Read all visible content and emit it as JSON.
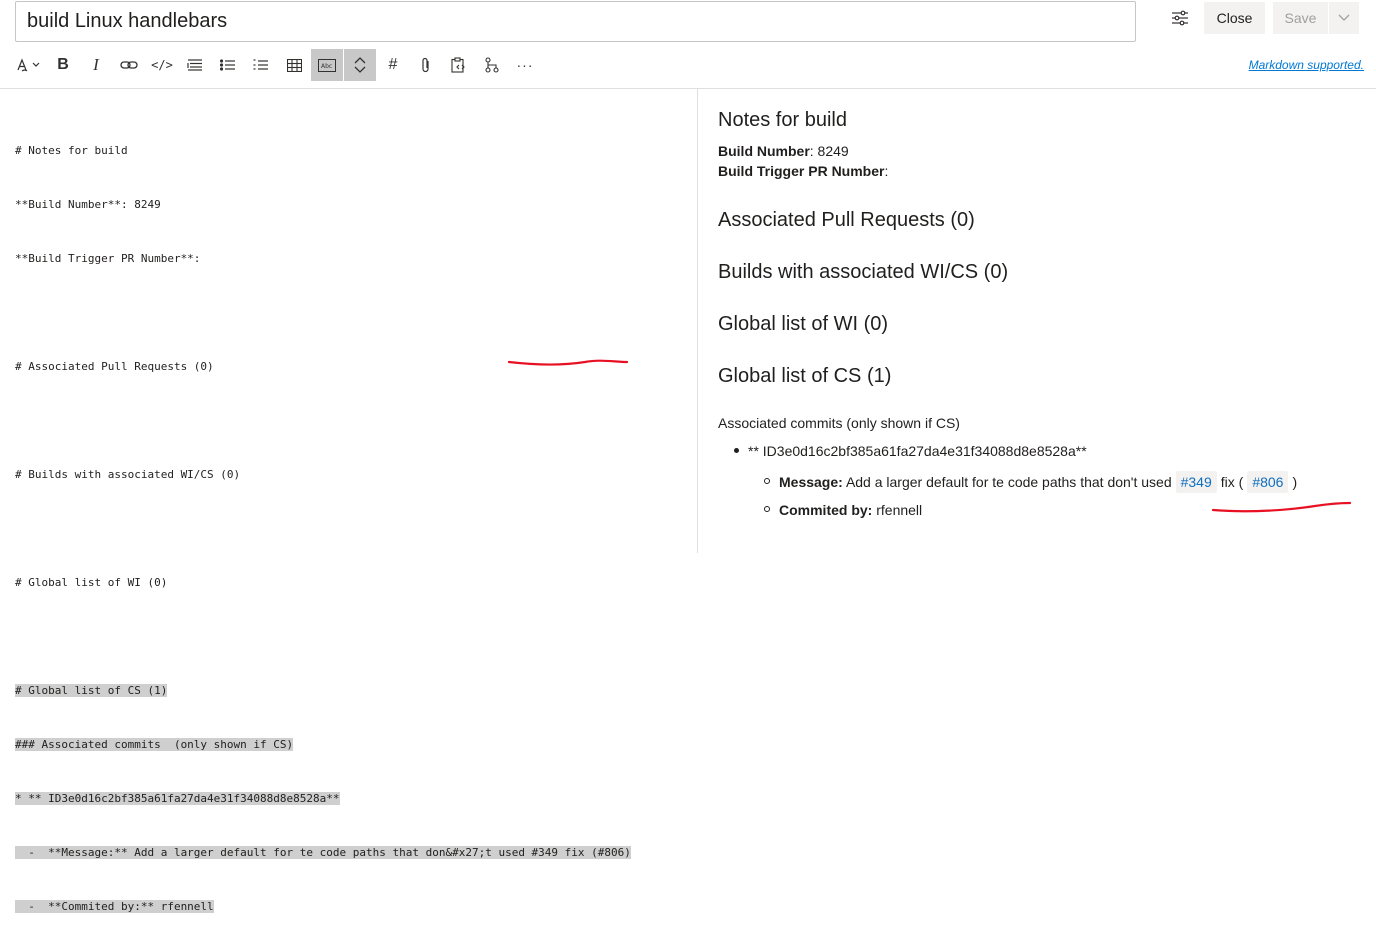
{
  "header": {
    "title_value": "build Linux handlebars",
    "close_label": "Close",
    "save_label": "Save"
  },
  "toolbar": {
    "buttons": [
      "text-style",
      "bold",
      "italic",
      "link",
      "code",
      "quote",
      "ordered-list",
      "bulleted-list",
      "table",
      "preview-toggle",
      "collapse-toggle",
      "heading",
      "attach",
      "paste-code",
      "mention-pr",
      "more"
    ],
    "bold_glyph": "B",
    "italic_glyph": "I",
    "heading_glyph": "#",
    "code_glyph": "</>",
    "more_glyph": "···",
    "markdown_link": "Markdown supported."
  },
  "editor": {
    "lines": [
      "# Notes for build",
      "**Build Number**: 8249",
      "**Build Trigger PR Number**:",
      "",
      "# Associated Pull Requests (0)",
      "",
      "# Builds with associated WI/CS (0)",
      "",
      "# Global list of WI (0)",
      "",
      "# Global list of CS (1)",
      "### Associated commits  (only shown if CS)",
      "* ** ID3e0d16c2bf385a61fa27da4e31f34088d8e8528a**",
      "  -  **Message:** Add a larger default for te code paths that don&#x27;t used #349 fix (#806)",
      "  -  **Commited by:** rfennell"
    ]
  },
  "preview": {
    "title": "Notes for build",
    "build_number_label": "Build Number",
    "build_number_value": ": 8249",
    "trigger_label": "Build Trigger PR Number",
    "trigger_value": ":",
    "h_prs": "Associated Pull Requests (0)",
    "h_builds": "Builds with associated WI/CS (0)",
    "h_wi": "Global list of WI (0)",
    "h_cs": "Global list of CS (1)",
    "commits_heading": "Associated commits (only shown if CS)",
    "commit_id": "** ID3e0d16c2bf385a61fa27da4e31f34088d8e8528a**",
    "message_label": "Message:",
    "message_text": "Add a larger default for te code paths that don't used",
    "tag_349": "#349",
    "fix_text": "fix (",
    "tag_806": "#806",
    "close_paren": ")",
    "committed_label": "Commited by:",
    "committed_value": "rfennell"
  },
  "colors": {
    "accent": "#0078d4",
    "annotation": "#e81123",
    "selection": "#cfcfcf"
  }
}
